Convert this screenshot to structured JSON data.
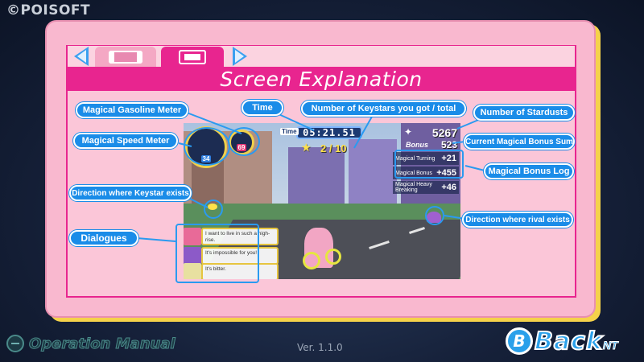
{
  "copyright": "©POISOFT",
  "header": {
    "title": "Screen Explanation",
    "tabs": [
      {
        "icon": "handheld-console-icon",
        "selected": false
      },
      {
        "icon": "tv-console-icon",
        "selected": true
      }
    ]
  },
  "labels": {
    "gasoline": "Magical Gasoline Meter",
    "speed": "Magical Speed Meter",
    "time": "Time",
    "keystars": "Number of Keystars you got / total",
    "stardusts": "Number of Stardusts",
    "bonus_sum": "Current Magical Bonus Sum",
    "bonus_log": "Magical Bonus Log",
    "keystar_direction": "Direction where Keystar exists",
    "dialogues": "Dialogues",
    "rival_direction": "Direction where rival exists"
  },
  "game_hud": {
    "time_tag": "Time",
    "time": "05:21.51",
    "keystars": "2 / 10",
    "stardusts": "5267",
    "bonus_tag": "Bonus",
    "bonus_sum": "523",
    "speed": "34",
    "gasoline": "69",
    "bonus_log": [
      {
        "name": "Magical Turning",
        "value": "+21"
      },
      {
        "name": "Magical Bonus",
        "value": "+455"
      },
      {
        "name": "Magical Heavy Breaking",
        "value": "+46"
      }
    ],
    "dialogues": [
      "I want to live in such a high-rise.",
      "It's impossible for you!",
      "It's bitter."
    ]
  },
  "footer": {
    "manual_title": "Operation Manual",
    "version": "Ver. 1.1.0",
    "back_key": "B",
    "back_label": "Back",
    "back_suffix": "NT"
  },
  "colors": {
    "panel_pink": "#f9b8cf",
    "accent_magenta": "#e8258f",
    "label_blue": "#1a8ce8",
    "panel_shadow_yellow": "#f5d24a"
  }
}
